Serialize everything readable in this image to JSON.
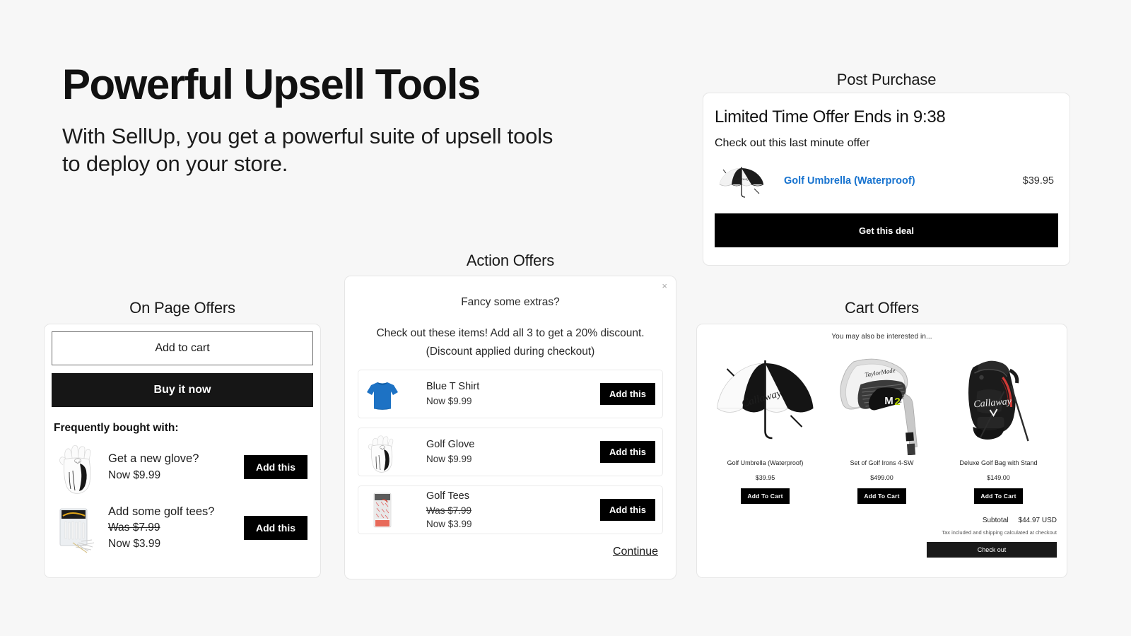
{
  "hero": {
    "title": "Powerful Upsell Tools",
    "subtitle": "With SellUp, you get a powerful suite of upsell tools to deploy on your store."
  },
  "post_purchase": {
    "label": "Post Purchase",
    "title": "Limited Time Offer Ends in 9:38",
    "subtitle": "Check out this last minute offer",
    "product": {
      "name": "Golf Umbrella (Waterproof)",
      "price": "$39.95",
      "image": "golf-umbrella"
    },
    "cta_label": "Get this deal",
    "link_color": "#1773cf"
  },
  "on_page_offers": {
    "label": "On Page Offers",
    "add_to_cart_label": "Add to cart",
    "buy_it_now_label": "Buy it now",
    "frequently_heading": "Frequently bought with:",
    "items": [
      {
        "title": "Get a new glove?",
        "was": "",
        "now": "Now $9.99",
        "button": "Add this",
        "image": "golf-glove"
      },
      {
        "title": "Add some golf tees?",
        "was": "Was $7.99",
        "now": "Now $3.99",
        "button": "Add this",
        "image": "golf-tees"
      }
    ]
  },
  "action_offers": {
    "label": "Action Offers",
    "close_label": "×",
    "heading": "Fancy some extras?",
    "description": "Check out these items! Add all 3 to get a 20% discount. (Discount applied during checkout)",
    "items": [
      {
        "title": "Blue T Shirt",
        "was": "",
        "now": "Now $9.99",
        "button": "Add this",
        "image": "blue-tshirt"
      },
      {
        "title": "Golf Glove",
        "was": "",
        "now": "Now $9.99",
        "button": "Add this",
        "image": "golf-glove"
      },
      {
        "title": "Golf Tees",
        "was": "Was $7.99",
        "now": "Now $3.99",
        "button": "Add this",
        "image": "golf-tees"
      }
    ],
    "continue_label": "Continue"
  },
  "cart_offers": {
    "label": "Cart Offers",
    "heading": "You may also be interested in...",
    "items": [
      {
        "name": "Golf Umbrella (Waterproof)",
        "price": "$39.95",
        "button": "Add To Cart",
        "image": "golf-umbrella"
      },
      {
        "name": "Set of Golf Irons 4-SW",
        "price": "$499.00",
        "button": "Add To Cart",
        "image": "golf-iron"
      },
      {
        "name": "Deluxe Golf Bag with Stand",
        "price": "$149.00",
        "button": "Add To Cart",
        "image": "golf-bag"
      }
    ],
    "subtotal_label": "Subtotal",
    "subtotal_value": "$44.97 USD",
    "tax_note": "Tax included and shipping calculated at checkout",
    "checkout_label": "Check out"
  },
  "theme": {
    "background": "#f7f7f7",
    "card_bg": "#ffffff",
    "text": "#1a1a1a",
    "accent_dark": "#000000",
    "tshirt_blue": "#1d72c4"
  }
}
